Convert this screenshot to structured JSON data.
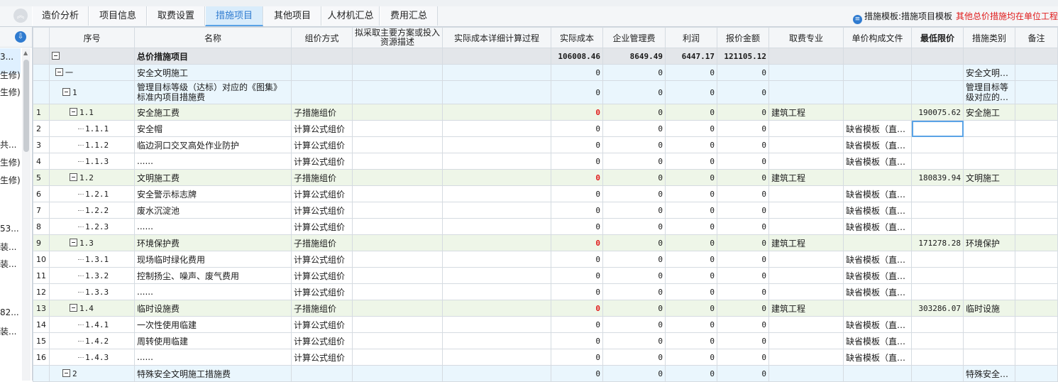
{
  "tabs": [
    {
      "label": "造价分析",
      "active": false
    },
    {
      "label": "项目信息",
      "active": false
    },
    {
      "label": "取费设置",
      "active": false
    },
    {
      "label": "措施项目",
      "active": true
    },
    {
      "label": "其他项目",
      "active": false
    },
    {
      "label": "人材机汇总",
      "active": false
    },
    {
      "label": "费用汇总",
      "active": false
    }
  ],
  "template": {
    "link": "措施模板:措施项目模板",
    "warning": "其他总价措施均在单位工程"
  },
  "left_panel": {
    "items": [
      "3...",
      "生修)",
      "生修)",
      "共...",
      "生修)",
      "生修)",
      "53...",
      "装...",
      "装...",
      "82...",
      "装..."
    ]
  },
  "columns": [
    "",
    "序号",
    "名称",
    "组价方式",
    "拟采取主要方案或投入资源描述",
    "实际成本详细计算过程",
    "实际成本",
    "企业管理费",
    "利润",
    "报价金额",
    "取费专业",
    "单价构成文件",
    "最低限价",
    "措施类别",
    "备注"
  ],
  "total": {
    "name": "总价措施项目",
    "cost": "106008.46",
    "mgmt": "8649.49",
    "profit": "6447.17",
    "quote": "121105.12"
  },
  "rows": [
    {
      "type": "cat",
      "no": "",
      "seq": "一",
      "name": "安全文明施工",
      "method": "",
      "cost": "0",
      "mgmt": "0",
      "profit": "0",
      "quote": "0",
      "major": "",
      "file": "",
      "limit": "",
      "cat": "安全文明…"
    },
    {
      "type": "cat2",
      "no": "",
      "seq": "1",
      "name": "管理目标等级（达标）对应的《图集》标准内项目措施费",
      "method": "",
      "cost": "0",
      "mgmt": "0",
      "profit": "0",
      "quote": "0",
      "major": "",
      "file": "",
      "limit": "",
      "cat": "管理目标等级对应的…"
    },
    {
      "type": "grp",
      "no": "1",
      "seq": "1.1",
      "name": "安全施工费",
      "method": "子措施组价",
      "cost": "0",
      "mgmt": "0",
      "profit": "0",
      "quote": "0",
      "major": "建筑工程",
      "file": "",
      "limit": "190075.62",
      "cat": "安全施工"
    },
    {
      "type": "item",
      "no": "2",
      "seq": "1.1.1",
      "name": "安全帽",
      "method": "计算公式组价",
      "cost": "0",
      "mgmt": "0",
      "profit": "0",
      "quote": "0",
      "major": "",
      "file": "缺省模板（直…",
      "limit": "",
      "cat": ""
    },
    {
      "type": "item",
      "no": "3",
      "seq": "1.1.2",
      "name": "临边洞口交叉高处作业防护",
      "method": "计算公式组价",
      "cost": "0",
      "mgmt": "0",
      "profit": "0",
      "quote": "0",
      "major": "",
      "file": "缺省模板（直…",
      "limit": "",
      "cat": ""
    },
    {
      "type": "item",
      "no": "4",
      "seq": "1.1.3",
      "name": "......",
      "method": "计算公式组价",
      "cost": "0",
      "mgmt": "0",
      "profit": "0",
      "quote": "0",
      "major": "",
      "file": "缺省模板（直…",
      "limit": "",
      "cat": ""
    },
    {
      "type": "grp",
      "no": "5",
      "seq": "1.2",
      "name": "文明施工费",
      "method": "子措施组价",
      "cost": "0",
      "mgmt": "0",
      "profit": "0",
      "quote": "0",
      "major": "建筑工程",
      "file": "",
      "limit": "180839.94",
      "cat": "文明施工"
    },
    {
      "type": "item",
      "no": "6",
      "seq": "1.2.1",
      "name": "安全警示标志牌",
      "method": "计算公式组价",
      "cost": "0",
      "mgmt": "0",
      "profit": "0",
      "quote": "0",
      "major": "",
      "file": "缺省模板（直…",
      "limit": "",
      "cat": ""
    },
    {
      "type": "item",
      "no": "7",
      "seq": "1.2.2",
      "name": "废水沉淀池",
      "method": "计算公式组价",
      "cost": "0",
      "mgmt": "0",
      "profit": "0",
      "quote": "0",
      "major": "",
      "file": "缺省模板（直…",
      "limit": "",
      "cat": ""
    },
    {
      "type": "item",
      "no": "8",
      "seq": "1.2.3",
      "name": "......",
      "method": "计算公式组价",
      "cost": "0",
      "mgmt": "0",
      "profit": "0",
      "quote": "0",
      "major": "",
      "file": "缺省模板（直…",
      "limit": "",
      "cat": ""
    },
    {
      "type": "grp",
      "no": "9",
      "seq": "1.3",
      "name": "环境保护费",
      "method": "子措施组价",
      "cost": "0",
      "mgmt": "0",
      "profit": "0",
      "quote": "0",
      "major": "建筑工程",
      "file": "",
      "limit": "171278.28",
      "cat": "环境保护"
    },
    {
      "type": "item",
      "no": "10",
      "seq": "1.3.1",
      "name": "现场临时绿化费用",
      "method": "计算公式组价",
      "cost": "0",
      "mgmt": "0",
      "profit": "0",
      "quote": "0",
      "major": "",
      "file": "缺省模板（直…",
      "limit": "",
      "cat": ""
    },
    {
      "type": "item",
      "no": "11",
      "seq": "1.3.2",
      "name": "控制扬尘、噪声、废气费用",
      "method": "计算公式组价",
      "cost": "0",
      "mgmt": "0",
      "profit": "0",
      "quote": "0",
      "major": "",
      "file": "缺省模板（直…",
      "limit": "",
      "cat": ""
    },
    {
      "type": "item",
      "no": "12",
      "seq": "1.3.3",
      "name": "......",
      "method": "计算公式组价",
      "cost": "0",
      "mgmt": "0",
      "profit": "0",
      "quote": "0",
      "major": "",
      "file": "缺省模板（直…",
      "limit": "",
      "cat": ""
    },
    {
      "type": "grp",
      "no": "13",
      "seq": "1.4",
      "name": "临时设施费",
      "method": "子措施组价",
      "cost": "0",
      "mgmt": "0",
      "profit": "0",
      "quote": "0",
      "major": "建筑工程",
      "file": "",
      "limit": "303286.07",
      "cat": "临时设施"
    },
    {
      "type": "item",
      "no": "14",
      "seq": "1.4.1",
      "name": "一次性使用临建",
      "method": "计算公式组价",
      "cost": "0",
      "mgmt": "0",
      "profit": "0",
      "quote": "0",
      "major": "",
      "file": "缺省模板（直…",
      "limit": "",
      "cat": ""
    },
    {
      "type": "item",
      "no": "15",
      "seq": "1.4.2",
      "name": "周转使用临建",
      "method": "计算公式组价",
      "cost": "0",
      "mgmt": "0",
      "profit": "0",
      "quote": "0",
      "major": "",
      "file": "缺省模板（直…",
      "limit": "",
      "cat": ""
    },
    {
      "type": "item",
      "no": "16",
      "seq": "1.4.3",
      "name": "......",
      "method": "计算公式组价",
      "cost": "0",
      "mgmt": "0",
      "profit": "0",
      "quote": "0",
      "major": "",
      "file": "缺省模板（直…",
      "limit": "",
      "cat": ""
    },
    {
      "type": "cat",
      "no": "",
      "seq": "2",
      "name": "特殊安全文明施工措施费",
      "method": "",
      "cost": "0",
      "mgmt": "0",
      "profit": "0",
      "quote": "0",
      "major": "",
      "file": "",
      "limit": "",
      "cat": "特殊安全…"
    }
  ]
}
